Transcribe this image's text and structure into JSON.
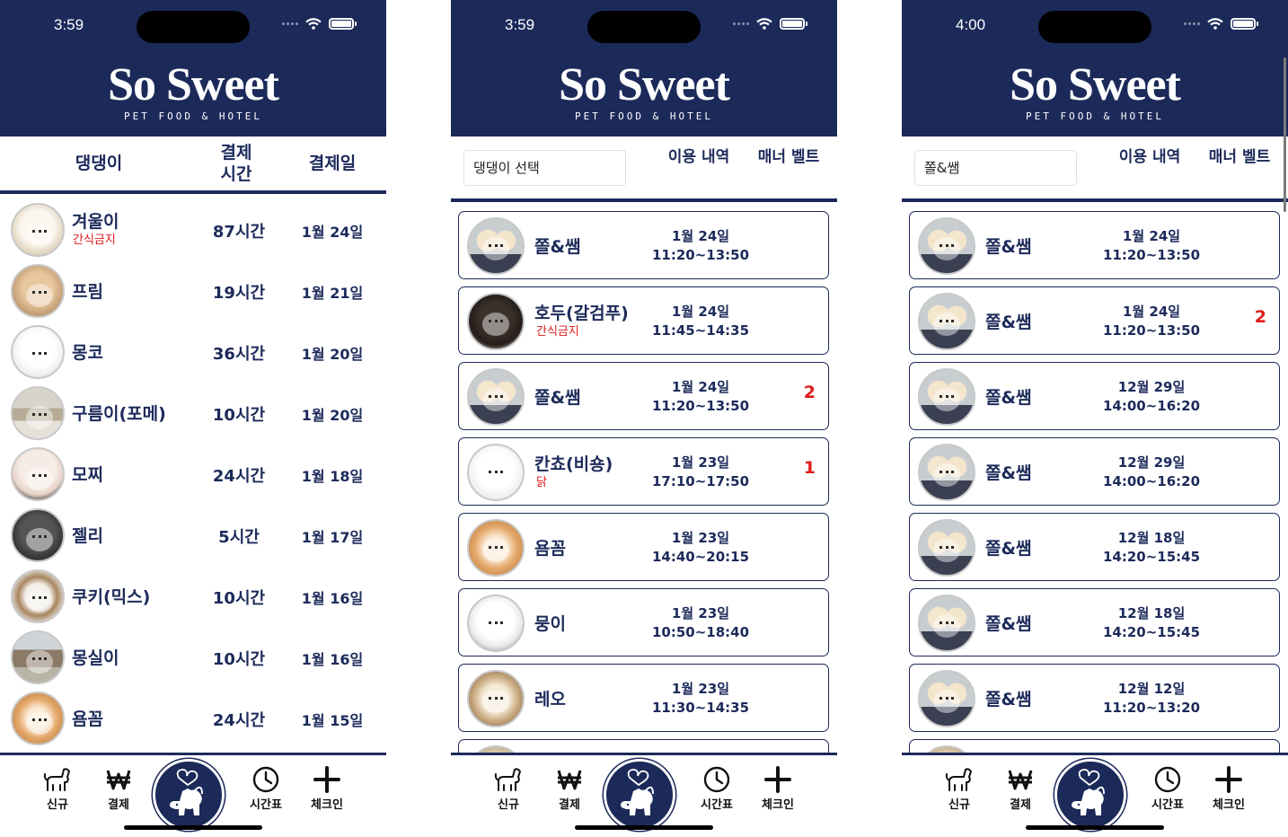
{
  "brand": {
    "title": "So Sweet",
    "tagline": "PET FOOD & HOTEL"
  },
  "colors": {
    "navy": "#1c2a5a",
    "alert": "#e01a1a"
  },
  "screens": [
    {
      "time": "3:59",
      "columns": {
        "dog": "댕댕이",
        "paid_hours": "결제 시간",
        "paid_date": "결제일"
      },
      "rows": [
        {
          "name": "겨울이",
          "note": "간식금지",
          "hours": "87시간",
          "date": "1월 24일"
        },
        {
          "name": "프림",
          "note": "",
          "hours": "19시간",
          "date": "1월 21일"
        },
        {
          "name": "몽코",
          "note": "",
          "hours": "36시간",
          "date": "1월 20일"
        },
        {
          "name": "구름이(포메)",
          "note": "",
          "hours": "10시간",
          "date": "1월 20일"
        },
        {
          "name": "모찌",
          "note": "",
          "hours": "24시간",
          "date": "1월 18일"
        },
        {
          "name": "젤리",
          "note": "",
          "hours": "5시간",
          "date": "1월 17일"
        },
        {
          "name": "쿠키(믹스)",
          "note": "",
          "hours": "10시간",
          "date": "1월 16일"
        },
        {
          "name": "몽실이",
          "note": "",
          "hours": "10시간",
          "date": "1월 16일"
        },
        {
          "name": "욤꼼",
          "note": "",
          "hours": "24시간",
          "date": "1월 15일"
        }
      ]
    },
    {
      "time": "3:59",
      "select": "댕댕이 선택",
      "history_label": "이용 내역",
      "manner_label": "매너 벨트",
      "cards": [
        {
          "name": "쫄&쌤",
          "note": "",
          "date": "1월 24일",
          "time": "11:20~13:50",
          "count": ""
        },
        {
          "name": "호두(갈검푸)",
          "note": "간식금지",
          "date": "1월 24일",
          "time": "11:45~14:35",
          "count": ""
        },
        {
          "name": "쫄&쌤",
          "note": "",
          "date": "1월 24일",
          "time": "11:20~13:50",
          "count": "2"
        },
        {
          "name": "칸쵸(비숑)",
          "note": "닭",
          "date": "1월 23일",
          "time": "17:10~17:50",
          "count": "1"
        },
        {
          "name": "욤꼼",
          "note": "",
          "date": "1월 23일",
          "time": "14:40~20:15",
          "count": ""
        },
        {
          "name": "뭉이",
          "note": "",
          "date": "1월 23일",
          "time": "10:50~18:40",
          "count": ""
        },
        {
          "name": "레오",
          "note": "",
          "date": "1월 23일",
          "time": "11:30~14:35",
          "count": ""
        }
      ]
    },
    {
      "time": "4:00",
      "select": "쫄&쌤",
      "history_label": "이용 내역",
      "manner_label": "매너 벨트",
      "cards": [
        {
          "name": "쫄&쌤",
          "note": "",
          "date": "1월 24일",
          "time": "11:20~13:50",
          "count": ""
        },
        {
          "name": "쫄&쌤",
          "note": "",
          "date": "1월 24일",
          "time": "11:20~13:50",
          "count": "2"
        },
        {
          "name": "쫄&쌤",
          "note": "",
          "date": "12월 29일",
          "time": "14:00~16:20",
          "count": ""
        },
        {
          "name": "쫄&쌤",
          "note": "",
          "date": "12월 29일",
          "time": "14:00~16:20",
          "count": ""
        },
        {
          "name": "쫄&쌤",
          "note": "",
          "date": "12월 18일",
          "time": "14:20~15:45",
          "count": ""
        },
        {
          "name": "쫄&쌤",
          "note": "",
          "date": "12월 18일",
          "time": "14:20~15:45",
          "count": ""
        },
        {
          "name": "쫄&쌤",
          "note": "",
          "date": "12월 12일",
          "time": "11:20~13:20",
          "count": ""
        }
      ]
    }
  ],
  "nav": {
    "new": "신규",
    "payment": "결제",
    "timetable": "시간표",
    "checkin": "체크인"
  }
}
